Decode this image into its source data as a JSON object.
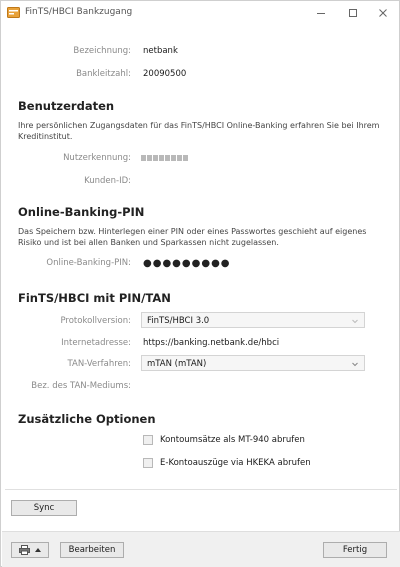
{
  "window": {
    "title": "FinTS/HBCI Bankzugang",
    "icons": {
      "app": "bank-app-icon",
      "minimize": "minimize-icon",
      "maximize": "maximize-icon",
      "close": "close-icon"
    }
  },
  "general": {
    "bezeichnung_label": "Bezeichnung:",
    "bezeichnung_value": "netbank",
    "blz_label": "Bankleitzahl:",
    "blz_value": "20090500"
  },
  "benutzerdaten": {
    "title": "Benutzerdaten",
    "description": "Ihre persönlichen Zugangsdaten für das FinTS/HBCI Online-Banking erfahren Sie bei Ihrem Kreditinstitut.",
    "nutzerkennung_label": "Nutzerkennung:",
    "kunden_id_label": "Kunden-ID:"
  },
  "pin": {
    "title": "Online-Banking-PIN",
    "description": "Das Speichern bzw. Hinterlegen einer PIN oder eines Passwortes geschieht auf eigenes Risiko und ist bei allen Banken und Sparkassen nicht zugelassen.",
    "pin_label": "Online-Banking-PIN:",
    "pin_value": "●●●●●●●●●"
  },
  "fints": {
    "title": "FinTS/HBCI mit PIN/TAN",
    "protokoll_label": "Protokollversion:",
    "protokoll_value": "FinTS/HBCI 3.0",
    "internet_label": "Internetadresse:",
    "internet_value": "https://banking.netbank.de/hbci",
    "tan_label": "TAN-Verfahren:",
    "tan_value": "mTAN (mTAN)",
    "medium_label": "Bez. des TAN-Mediums:"
  },
  "options": {
    "title": "Zusätzliche Optionen",
    "mt940_label": "Kontoumsätze als MT-940 abrufen",
    "mt940_checked": false,
    "hkeka_label": "E-Kontoauszüge via HKEKA abrufen",
    "hkeka_checked": false
  },
  "buttons": {
    "sync": "Sync",
    "bearbeiten": "Bearbeiten",
    "fertig": "Fertig",
    "print_icon": "printer-icon",
    "print_menu_icon": "caret-up-icon"
  }
}
